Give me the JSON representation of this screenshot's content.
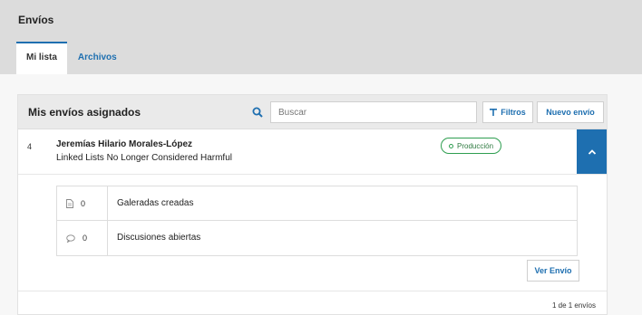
{
  "header": {
    "title": "Envíos",
    "tabs": [
      {
        "label": "Mi lista",
        "active": true
      },
      {
        "label": "Archivos",
        "active": false
      }
    ]
  },
  "panel": {
    "title": "Mis envíos asignados",
    "search": {
      "placeholder": "Buscar",
      "value": ""
    },
    "filter_label": "Filtros",
    "new_label": "Nuevo envío"
  },
  "submission": {
    "id": "4",
    "author": "Jeremías Hilario Morales-López",
    "title": "Linked Lists No Longer Considered Harmful",
    "status": "Producción",
    "details": [
      {
        "icon": "file-icon",
        "count": "0",
        "label": "Galeradas creadas"
      },
      {
        "icon": "comment-icon",
        "count": "0",
        "label": "Discusiones abiertas"
      }
    ],
    "view_label": "Ver Envío"
  },
  "pagination": "1 de 1 envíos",
  "colors": {
    "accent": "#1e6fb0",
    "status": "#2e9e50",
    "header_bg": "#dcdcdc"
  }
}
